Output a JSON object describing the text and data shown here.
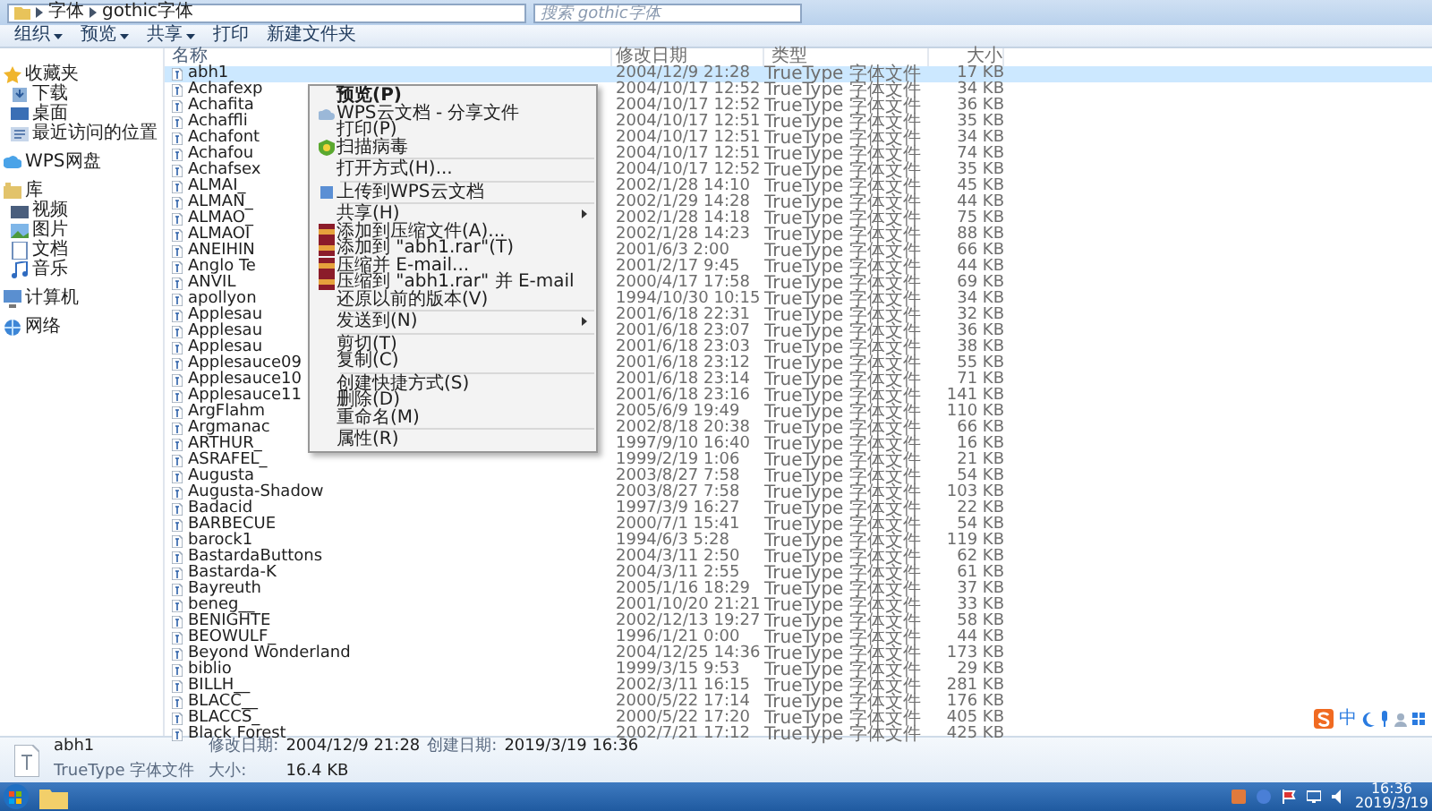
{
  "address": {
    "path": [
      "字体",
      "gothic字体"
    ],
    "search_placeholder": "搜索 gothic字体"
  },
  "toolbar": [
    {
      "label": "组织",
      "dropdown": true
    },
    {
      "label": "预览",
      "dropdown": true
    },
    {
      "label": "共享",
      "dropdown": true
    },
    {
      "label": "打印",
      "dropdown": false
    },
    {
      "label": "新建文件夹",
      "dropdown": false
    }
  ],
  "sidebar": [
    {
      "label": "收藏夹",
      "kind": "group"
    },
    {
      "label": "下载",
      "kind": "item"
    },
    {
      "label": "桌面",
      "kind": "item"
    },
    {
      "label": "最近访问的位置",
      "kind": "item"
    },
    {
      "label": "WPS网盘",
      "kind": "group"
    },
    {
      "label": "库",
      "kind": "group"
    },
    {
      "label": "视频",
      "kind": "item"
    },
    {
      "label": "图片",
      "kind": "item"
    },
    {
      "label": "文档",
      "kind": "item"
    },
    {
      "label": "音乐",
      "kind": "item"
    },
    {
      "label": "计算机",
      "kind": "group"
    },
    {
      "label": "网络",
      "kind": "group"
    }
  ],
  "columns": [
    "名称",
    "修改日期",
    "类型",
    "大小"
  ],
  "rows": [
    {
      "name": "abh1",
      "date": "2004/12/9 21:28",
      "type": "TrueType 字体文件",
      "size": "17 KB",
      "selected": true
    },
    {
      "name": "Achafexp",
      "date": "2004/10/17 12:52",
      "type": "TrueType 字体文件",
      "size": "34 KB",
      "selected": false
    },
    {
      "name": "Achafita",
      "date": "2004/10/17 12:52",
      "type": "TrueType 字体文件",
      "size": "36 KB",
      "selected": false
    },
    {
      "name": "Achaffli",
      "date": "2004/10/17 12:51",
      "type": "TrueType 字体文件",
      "size": "35 KB",
      "selected": false
    },
    {
      "name": "Achafont",
      "date": "2004/10/17 12:51",
      "type": "TrueType 字体文件",
      "size": "34 KB",
      "selected": false
    },
    {
      "name": "Achafou",
      "date": "2004/10/17 12:51",
      "type": "TrueType 字体文件",
      "size": "74 KB",
      "selected": false
    },
    {
      "name": "Achafsex",
      "date": "2004/10/17 12:52",
      "type": "TrueType 字体文件",
      "size": "35 KB",
      "selected": false
    },
    {
      "name": "ALMAI_",
      "date": "2002/1/28 14:10",
      "type": "TrueType 字体文件",
      "size": "45 KB",
      "selected": false
    },
    {
      "name": "ALMAN_",
      "date": "2002/1/29 14:28",
      "type": "TrueType 字体文件",
      "size": "44 KB",
      "selected": false
    },
    {
      "name": "ALMAO_",
      "date": "2002/1/28 14:18",
      "type": "TrueType 字体文件",
      "size": "75 KB",
      "selected": false
    },
    {
      "name": "ALMAOI",
      "date": "2002/1/28 14:23",
      "type": "TrueType 字体文件",
      "size": "88 KB",
      "selected": false
    },
    {
      "name": "ANEIHIN",
      "date": "2001/6/3 2:00",
      "type": "TrueType 字体文件",
      "size": "66 KB",
      "selected": false
    },
    {
      "name": "Anglo Te",
      "date": "2001/2/17 9:45",
      "type": "TrueType 字体文件",
      "size": "44 KB",
      "selected": false
    },
    {
      "name": "ANVIL",
      "date": "2000/4/17 17:58",
      "type": "TrueType 字体文件",
      "size": "69 KB",
      "selected": false
    },
    {
      "name": "apollyon",
      "date": "1994/10/30 10:15",
      "type": "TrueType 字体文件",
      "size": "34 KB",
      "selected": false
    },
    {
      "name": "Applesau",
      "date": "2001/6/18 22:31",
      "type": "TrueType 字体文件",
      "size": "32 KB",
      "selected": false
    },
    {
      "name": "Applesau",
      "date": "2001/6/18 23:07",
      "type": "TrueType 字体文件",
      "size": "36 KB",
      "selected": false
    },
    {
      "name": "Applesau",
      "date": "2001/6/18 23:03",
      "type": "TrueType 字体文件",
      "size": "38 KB",
      "selected": false
    },
    {
      "name": "Applesauce09",
      "date": "2001/6/18 23:12",
      "type": "TrueType 字体文件",
      "size": "55 KB",
      "selected": false
    },
    {
      "name": "Applesauce10",
      "date": "2001/6/18 23:14",
      "type": "TrueType 字体文件",
      "size": "71 KB",
      "selected": false
    },
    {
      "name": "Applesauce11",
      "date": "2001/6/18 23:16",
      "type": "TrueType 字体文件",
      "size": "141 KB",
      "selected": false
    },
    {
      "name": "ArgFlahm",
      "date": "2005/6/9 19:49",
      "type": "TrueType 字体文件",
      "size": "110 KB",
      "selected": false
    },
    {
      "name": "Argmanac",
      "date": "2002/8/18 20:38",
      "type": "TrueType 字体文件",
      "size": "66 KB",
      "selected": false
    },
    {
      "name": "ARTHUR_",
      "date": "1997/9/10 16:40",
      "type": "TrueType 字体文件",
      "size": "16 KB",
      "selected": false
    },
    {
      "name": "ASRAFEL_",
      "date": "1999/2/19 1:06",
      "type": "TrueType 字体文件",
      "size": "21 KB",
      "selected": false
    },
    {
      "name": "Augusta",
      "date": "2003/8/27 7:58",
      "type": "TrueType 字体文件",
      "size": "54 KB",
      "selected": false
    },
    {
      "name": "Augusta-Shadow",
      "date": "2003/8/27 7:58",
      "type": "TrueType 字体文件",
      "size": "103 KB",
      "selected": false
    },
    {
      "name": "Badacid",
      "date": "1997/3/9 16:27",
      "type": "TrueType 字体文件",
      "size": "22 KB",
      "selected": false
    },
    {
      "name": "BARBECUE",
      "date": "2000/7/1 15:41",
      "type": "TrueType 字体文件",
      "size": "54 KB",
      "selected": false
    },
    {
      "name": "barock1",
      "date": "1994/6/3 5:28",
      "type": "TrueType 字体文件",
      "size": "119 KB",
      "selected": false
    },
    {
      "name": "BastardaButtons",
      "date": "2004/3/11 2:50",
      "type": "TrueType 字体文件",
      "size": "62 KB",
      "selected": false
    },
    {
      "name": "Bastarda-K",
      "date": "2004/3/11 2:55",
      "type": "TrueType 字体文件",
      "size": "61 KB",
      "selected": false
    },
    {
      "name": "Bayreuth",
      "date": "2005/1/16 18:29",
      "type": "TrueType 字体文件",
      "size": "37 KB",
      "selected": false
    },
    {
      "name": "beneg__",
      "date": "2001/10/20 21:21",
      "type": "TrueType 字体文件",
      "size": "33 KB",
      "selected": false
    },
    {
      "name": "BENIGHTE",
      "date": "2002/12/13 19:27",
      "type": "TrueType 字体文件",
      "size": "58 KB",
      "selected": false
    },
    {
      "name": "BEOWULF_",
      "date": "1996/1/21 0:00",
      "type": "TrueType 字体文件",
      "size": "44 KB",
      "selected": false
    },
    {
      "name": "Beyond Wonderland",
      "date": "2004/12/25 14:36",
      "type": "TrueType 字体文件",
      "size": "173 KB",
      "selected": false
    },
    {
      "name": "biblio",
      "date": "1999/3/15 9:53",
      "type": "TrueType 字体文件",
      "size": "29 KB",
      "selected": false
    },
    {
      "name": "BILLH__",
      "date": "2002/3/11 16:15",
      "type": "TrueType 字体文件",
      "size": "281 KB",
      "selected": false
    },
    {
      "name": "BLACC__",
      "date": "2000/5/22 17:14",
      "type": "TrueType 字体文件",
      "size": "176 KB",
      "selected": false
    },
    {
      "name": "BLACCS_",
      "date": "2000/5/22 17:20",
      "type": "TrueType 字体文件",
      "size": "405 KB",
      "selected": false
    },
    {
      "name": "Black Forest",
      "date": "2002/7/21 17:12",
      "type": "TrueType 字体文件",
      "size": "425 KB",
      "selected": false
    }
  ],
  "context_menu": [
    {
      "kind": "item",
      "label": "预览(P)",
      "default": true,
      "submenu": false
    },
    {
      "kind": "item",
      "label": "WPS云文档 - 分享文件",
      "default": false,
      "submenu": false
    },
    {
      "kind": "item",
      "label": "打印(P)",
      "default": false,
      "submenu": false
    },
    {
      "kind": "item",
      "label": "扫描病毒",
      "default": false,
      "submenu": false
    },
    {
      "kind": "separator"
    },
    {
      "kind": "item",
      "label": "打开方式(H)...",
      "default": false,
      "submenu": false
    },
    {
      "kind": "separator"
    },
    {
      "kind": "item",
      "label": "上传到WPS云文档",
      "default": false,
      "submenu": false
    },
    {
      "kind": "separator"
    },
    {
      "kind": "item",
      "label": "共享(H)",
      "default": false,
      "submenu": true
    },
    {
      "kind": "item",
      "label": "添加到压缩文件(A)...",
      "default": false,
      "submenu": false
    },
    {
      "kind": "item",
      "label": "添加到 \"abh1.rar\"(T)",
      "default": false,
      "submenu": false
    },
    {
      "kind": "item",
      "label": "压缩并 E-mail...",
      "default": false,
      "submenu": false
    },
    {
      "kind": "item",
      "label": "压缩到 \"abh1.rar\" 并 E-mail",
      "default": false,
      "submenu": false
    },
    {
      "kind": "item",
      "label": "还原以前的版本(V)",
      "default": false,
      "submenu": false
    },
    {
      "kind": "separator"
    },
    {
      "kind": "item",
      "label": "发送到(N)",
      "default": false,
      "submenu": true
    },
    {
      "kind": "separator"
    },
    {
      "kind": "item",
      "label": "剪切(T)",
      "default": false,
      "submenu": false
    },
    {
      "kind": "item",
      "label": "复制(C)",
      "default": false,
      "submenu": false
    },
    {
      "kind": "separator"
    },
    {
      "kind": "item",
      "label": "创建快捷方式(S)",
      "default": false,
      "submenu": false
    },
    {
      "kind": "item",
      "label": "删除(D)",
      "default": false,
      "submenu": false
    },
    {
      "kind": "item",
      "label": "重命名(M)",
      "default": false,
      "submenu": false
    },
    {
      "kind": "separator"
    },
    {
      "kind": "item",
      "label": "属性(R)",
      "default": false,
      "submenu": false
    }
  ],
  "details": {
    "name": "abh1",
    "type": "TrueType 字体文件",
    "fields": [
      {
        "label": "修改日期:",
        "value": "2004/12/9 21:28"
      },
      {
        "label": "创建日期:",
        "value": "2019/3/19 16:36"
      },
      {
        "label": "大小:",
        "value": "16.4 KB"
      }
    ]
  },
  "ime": {
    "label": "中"
  },
  "clock": {
    "time": "16:36",
    "date": "2019/3/19"
  }
}
